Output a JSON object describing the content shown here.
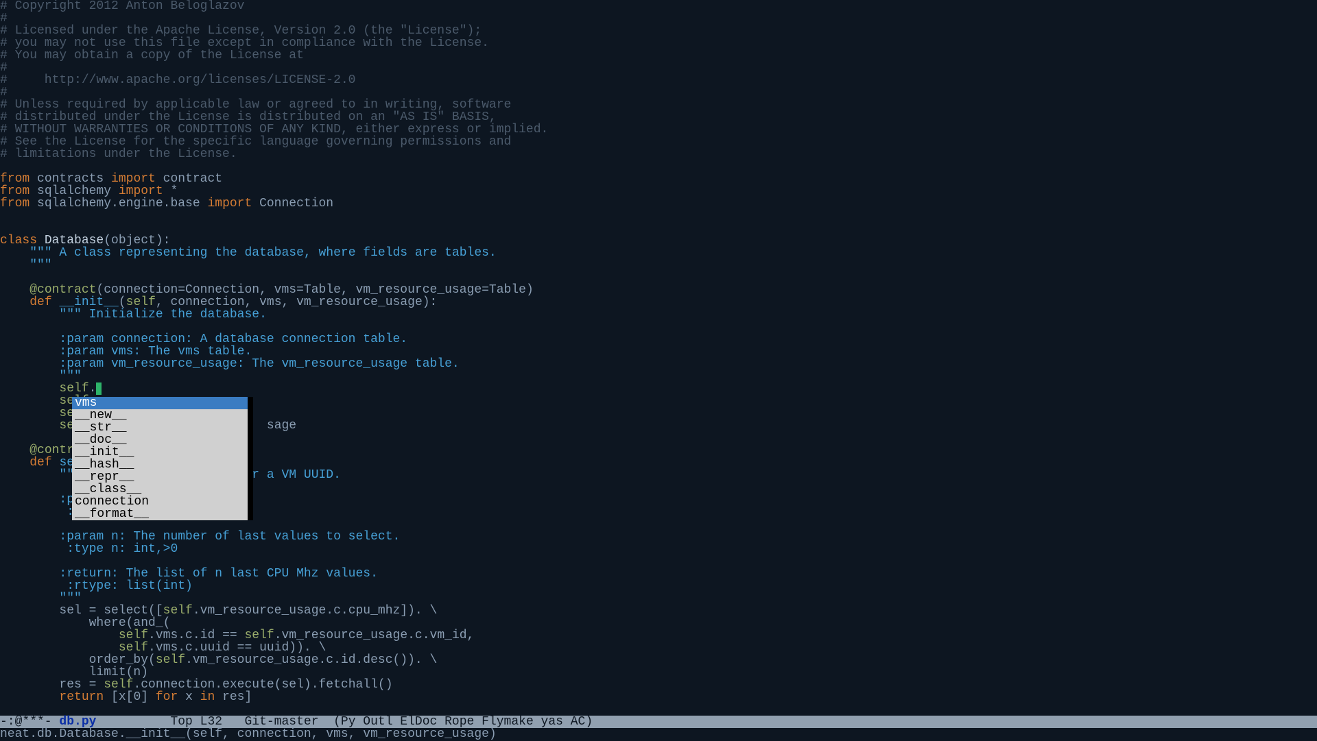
{
  "code": {
    "comments": [
      "# Copyright 2012 Anton Beloglazov",
      "#",
      "# Licensed under the Apache License, Version 2.0 (the \"License\");",
      "# you may not use this file except in compliance with the License.",
      "# You may obtain a copy of the License at",
      "#",
      "#     http://www.apache.org/licenses/LICENSE-2.0",
      "#",
      "# Unless required by applicable law or agreed to in writing, software",
      "# distributed under the License is distributed on an \"AS IS\" BASIS,",
      "# WITHOUT WARRANTIES OR CONDITIONS OF ANY KIND, either express or implied.",
      "# See the License for the specific language governing permissions and",
      "# limitations under the License."
    ],
    "kw_from": "from",
    "kw_import": "import",
    "kw_class": "class",
    "kw_def": "def",
    "kw_for": "for",
    "kw_in": "in",
    "kw_return": "return",
    "mod_contracts": " contracts ",
    "mod_contract": " contract",
    "mod_sqlalchemy": " sqlalchemy ",
    "star": " *",
    "mod_engine": " sqlalchemy.engine.base ",
    "mod_connection": " Connection",
    "classname": " Database",
    "class_sig": "(object):",
    "docq": "\"\"\"",
    "class_doc": " A class representing the database, where fields are tables.",
    "indent_docq": "    \"\"\"",
    "dec_contract": "@contract",
    "dec_args1": "(connection=Connection, vms=Table, vm_resource_usage=Table)",
    "init_name": "__init__",
    "tok_self": "self",
    "init_args": ", connection, vms, vm_resource_usage):",
    "open_paren": "(",
    "init_doc_open": " Initialize the database.",
    "init_p1": "        :param connection: A database connection table.",
    "init_p2": "        :param vms: The vms table.",
    "init_p3": "        :param vm_resource_usage: The vm_resource_usage table.",
    "self_dot": ".",
    "hidden_tail": "sage",
    "sele_name": "sele",
    "sele_doc_tail": "r a VM UUID.",
    "sele_par": "        :par",
    "sele_ty": "         :ty",
    "sele_p3": "        :param n: The number of last values to select.",
    "sele_t3": "         :type n: int,>0",
    "sele_ret": "        :return: The list of n last CPU Mhz values.",
    "sele_rtype": "         :rtype: list(int)",
    "sel_line_pre": "        sel = select([",
    "sel_line_post": ".vm_resource_usage.c.cpu_mhz]). \\",
    "where_line": "            where(and_(",
    "where1_post": ".vms.c.id == ",
    "where1_end": ".vm_resource_usage.c.vm_id,",
    "where2_post": ".vms.c.uuid == uuid)). \\",
    "orderby_pre": "            order_by(",
    "orderby_post": ".vm_resource_usage.c.id.desc()). \\",
    "limit_line": "            limit(n)",
    "res_pre": "        res = ",
    "res_post": ".connection.execute(sel).fetchall()",
    "return_pre": "        ",
    "return_body": " [x[0] ",
    "return_mid": " x ",
    "return_end": " res]"
  },
  "popup": {
    "items": [
      "vms",
      "__new__",
      "__str__",
      "__doc__",
      "__init__",
      "__hash__",
      "__repr__",
      "__class__",
      "connection",
      "__format__"
    ]
  },
  "modeline": {
    "left": "-:@***- ",
    "filename": "db.py",
    "right": "          Top L32   Git-master  (Py Outl ElDoc Rope Flymake yas AC)"
  },
  "minibuffer": "neat.db.Database.__init__(self, connection, vms, vm_resource_usage)"
}
